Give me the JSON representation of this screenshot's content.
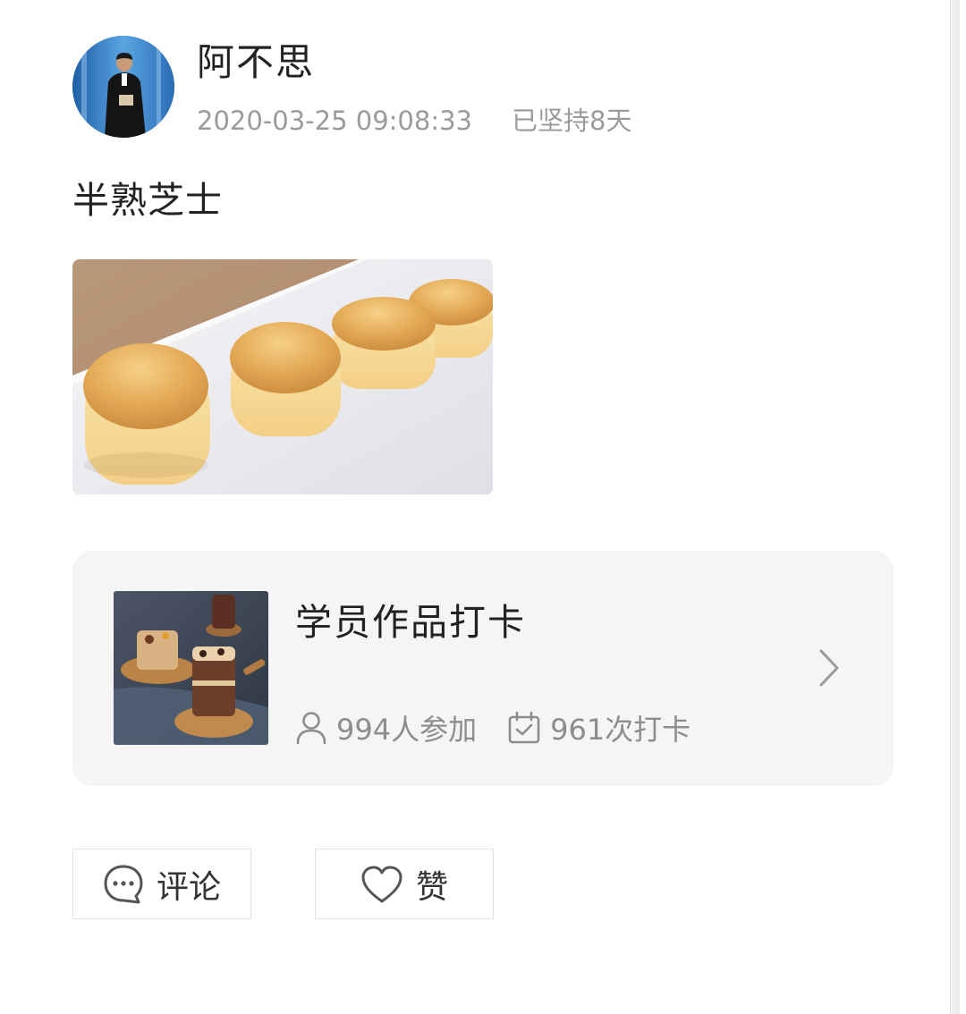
{
  "post": {
    "author_name": "阿不思",
    "timestamp": "2020-03-25 09:08:33",
    "streak": "已坚持8天",
    "text": "半熟芝士"
  },
  "activity": {
    "title": "学员作品打卡",
    "participants": "994人参加",
    "checkins": "961次打卡"
  },
  "actions": {
    "comment_label": "评论",
    "like_label": "赞"
  },
  "icons": {
    "participants": "person-icon",
    "checkins": "calendar-check-icon",
    "comment": "chat-bubble-icon",
    "like": "heart-icon",
    "more": "chevron-right-icon"
  }
}
